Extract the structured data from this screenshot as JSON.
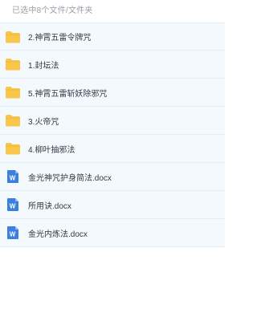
{
  "header": {
    "selection_text": "已选中8个文件/文件夹"
  },
  "items": [
    {
      "name": "2.神霄五雷令牌咒",
      "type": "folder",
      "icon": "folder-icon"
    },
    {
      "name": "1.封坛法",
      "type": "folder",
      "icon": "folder-icon"
    },
    {
      "name": "5.神霄五雷斩妖除邪咒",
      "type": "folder",
      "icon": "folder-icon"
    },
    {
      "name": "3.火帝咒",
      "type": "folder",
      "icon": "folder-icon"
    },
    {
      "name": "4.柳叶抽邪法",
      "type": "folder",
      "icon": "folder-icon"
    },
    {
      "name": "金光神咒护身简法.docx",
      "type": "docx",
      "icon": "word-doc-icon"
    },
    {
      "name": "所用诀.docx",
      "type": "docx",
      "icon": "word-doc-icon"
    },
    {
      "name": "金光内炼法.docx",
      "type": "docx",
      "icon": "word-doc-icon"
    }
  ],
  "colors": {
    "folder": "#f7c64a",
    "folder_tab": "#f0b52f",
    "word": "#3d7fe0",
    "row_bg": "#f4f9fe",
    "row_border": "#e3eef9"
  }
}
